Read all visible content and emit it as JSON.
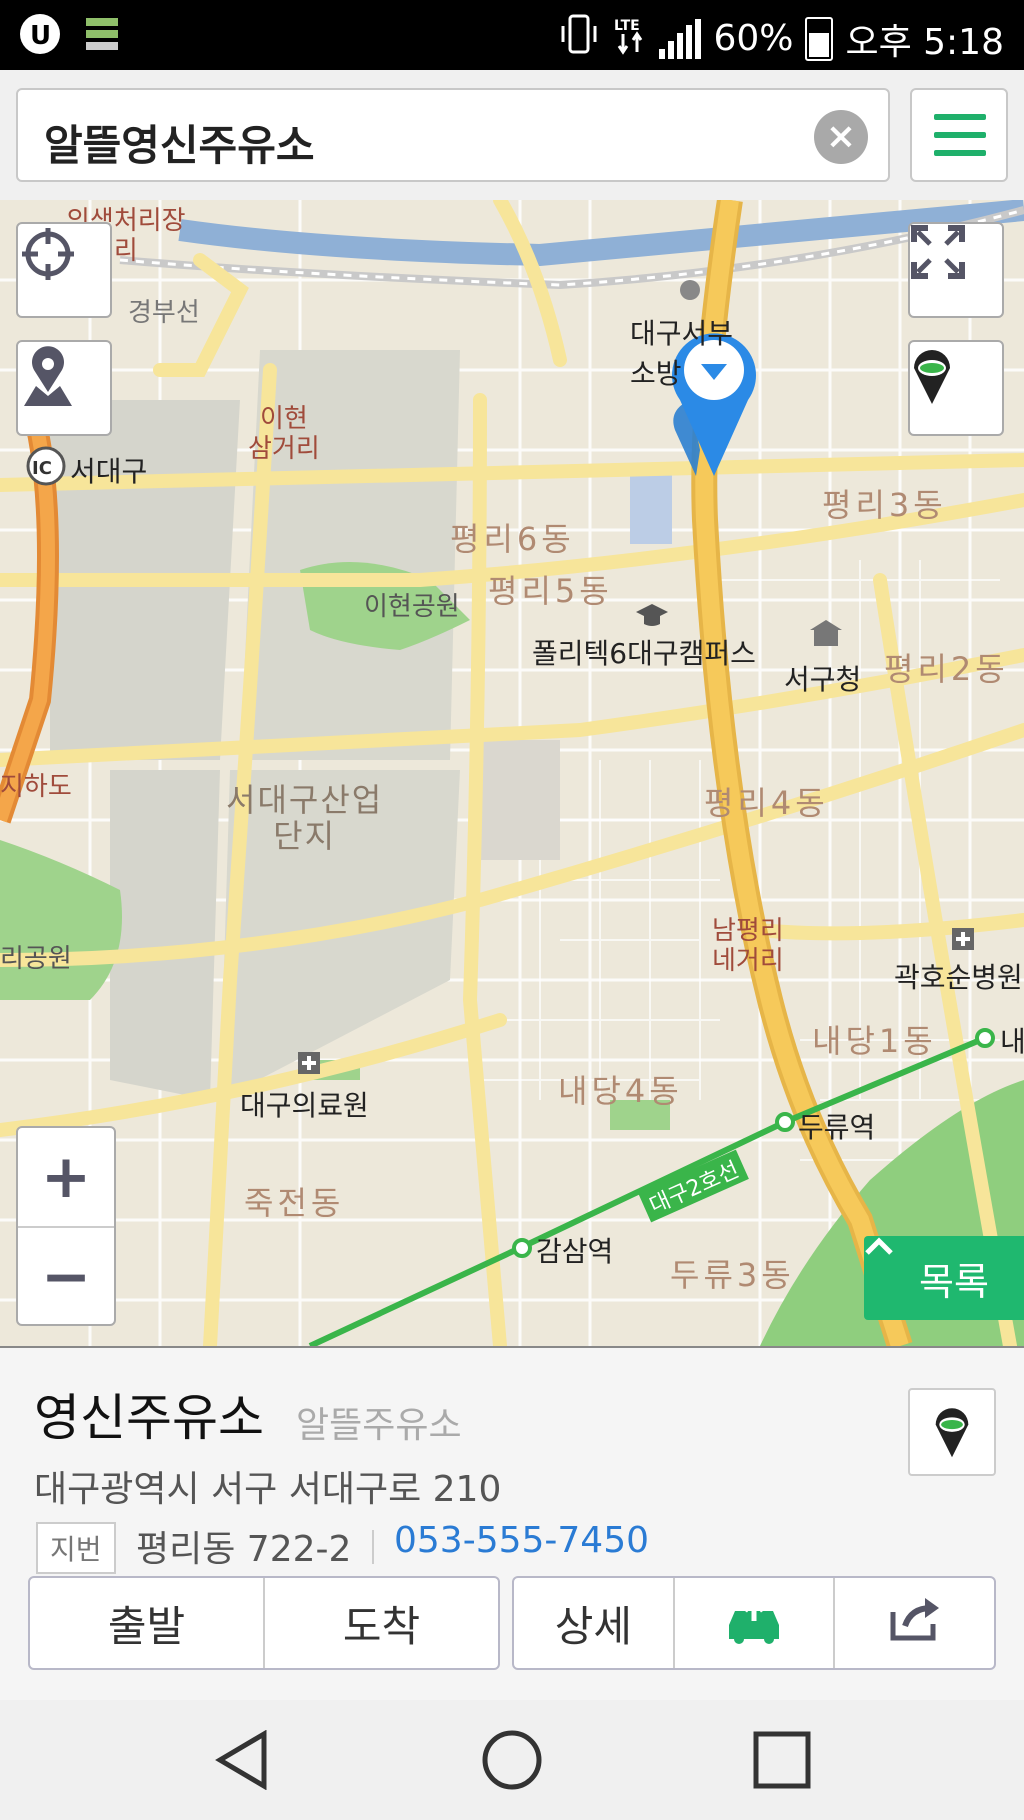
{
  "status_bar": {
    "battery": "60%",
    "time": "오후 5:18",
    "network": "LTE",
    "icons": [
      "u-plus-icon",
      "sim-stack-icon",
      "vibrate-icon",
      "lte-icon",
      "signal-icon",
      "battery-icon"
    ]
  },
  "search": {
    "query": "알뜰영신주유소"
  },
  "map": {
    "labels": {
      "l1": "의생처리장\n사거리",
      "l2": "경부선",
      "l3": "대구서부\n소방",
      "l4": "이현\n삼거리",
      "l5": "서대구",
      "l6": "평리6동",
      "l7": "평리5동",
      "l8": "이현공원",
      "l9": "폴리텍6대구캠퍼스",
      "l10": "서구청",
      "l11": "평리3동",
      "l12": "평리2동",
      "l13": "서대구산업\n단지",
      "l14": "평리4동",
      "l15": "남평리\n네거리",
      "l16": "곽호순병원",
      "l17": "내당1동",
      "l18": "내",
      "l19": "대구의료원",
      "l20": "내당4동",
      "l21": "두류역",
      "l22": "대구2호선",
      "l23": "죽전동",
      "l24": "감삼역",
      "l25": "두류3동",
      "l26": "지하도",
      "l27": "리공원",
      "l28": "사거리"
    },
    "zoom_in": "+",
    "zoom_out": "−",
    "list_label": "목록",
    "colors": {
      "road_major": "#f5c85a",
      "road_yellow": "#f7e59a",
      "park": "#9fd38c",
      "water": "#8fb0d6",
      "subway": "#3ab54a",
      "pin": "#2b8ae6"
    }
  },
  "place": {
    "name": "영신주유소",
    "category": "알뜰주유소",
    "address": "대구광역시 서구 서대구로 210",
    "jibun_label": "지번",
    "jibun": "평리동 722-2",
    "phone": "053-555-7450"
  },
  "actions": {
    "depart": "출발",
    "arrive": "도착",
    "detail": "상세"
  }
}
